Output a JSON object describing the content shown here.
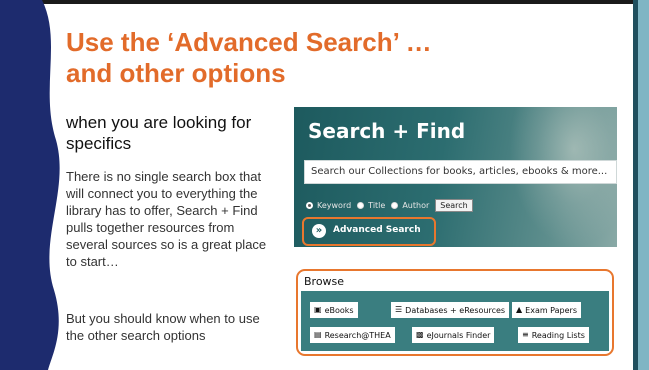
{
  "slide": {
    "title_line1": "Use the ‘Advanced Search’ …",
    "title_line2": "and other options",
    "subtitle": "when you are looking for specifics",
    "body_1": "There is no single search box that will connect you to everything the library has to offer, Search + Find  pulls together resources from several sources so is a great place to start…",
    "body_2": "But you should know when to use the other search options"
  },
  "search_panel": {
    "title": "Search + Find",
    "input_value": "Search our Collections for books, articles, ebooks & more...",
    "radio_options": [
      "Keyword",
      "Title",
      "Author"
    ],
    "selected_option": "Keyword",
    "search_button": "Search",
    "advanced_search": "Advanced Search"
  },
  "browse": {
    "label": "Browse",
    "buttons": [
      "eBooks",
      "Databases + eResources",
      "Exam Papers",
      "Research@THEA",
      "eJournals Finder",
      "Reading Lists"
    ]
  },
  "colors": {
    "title_orange": "#e26b2a",
    "highlight_orange": "#e8772e",
    "panel_teal": "#1d5a5e",
    "wave_navy": "#1d2b6e",
    "rail_blue": "#7fb5c4"
  },
  "icons": {
    "ebooks": "book-icon",
    "databases": "list-icon",
    "exam_papers": "graduation-cap-icon",
    "research": "research-icon",
    "ejournals": "journal-icon",
    "reading_lists": "checklist-icon",
    "advanced": "double-chevron-icon"
  }
}
